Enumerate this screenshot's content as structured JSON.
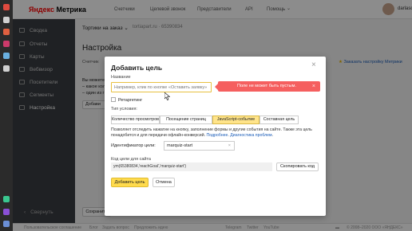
{
  "header": {
    "logo_ya": "Яндекс",
    "logo_rest": " Метрика",
    "nav": [
      "Счетчики",
      "Целевой звонок",
      "Представители",
      "API",
      "Помощь"
    ],
    "help_caret": "⌄",
    "user": "darlasoft"
  },
  "sidebar": {
    "items": [
      "Сводка",
      "Отчеты",
      "Карты",
      "Вебвизор",
      "Посетители",
      "Сегменты",
      "Настройка"
    ],
    "collapse": "Свернуть"
  },
  "page": {
    "counter_select": "Тортики на заказ",
    "counter_caret": "⌄",
    "site": "tortiapart.ru · 65390834",
    "title": "Настройка",
    "tab_partial": "Счетчик",
    "order_link": "Заказать настройку Метрики",
    "text1": "Вы можете с",
    "text2": "– какое кол",
    "text3": "– один из г",
    "add_partial": "Добави",
    "save": "Сохранить"
  },
  "modal": {
    "title": "Добавить цель",
    "close": "×",
    "name_label": "Название",
    "name_placeholder": "Например, клик по кнопке «Оставить заявку»",
    "retarget": "Ретаргетинг",
    "cond_label": "Тип условия:",
    "tabs": [
      "Количество просмотров",
      "Посещение страниц",
      "JavaScript-событие",
      "Составная цель"
    ],
    "desc1": "Позволяет отследить нажатие на кнопку, заполнение формы и другие события на сайте. Также эта цель",
    "desc2a": "понадобится и для передачи офлайн-конверсий. ",
    "desc2b": "Подробнее",
    "desc2c": ". ",
    "desc2d": "Диагностика проблем",
    "desc2e": ".",
    "id_label": "Идентификатор цели:",
    "id_value": "marquiz-start",
    "id_clear": "×",
    "code_label": "Код цели для сайта",
    "code_value": "ym(65380834,'reachGoal','marquiz-start')",
    "copy_btn": "Скопировать код",
    "submit": "Добавить цель",
    "cancel": "Отмена"
  },
  "error": {
    "text": "Поле не может быть пустым.",
    "icon": "×"
  },
  "footer": {
    "left": [
      "Пользовательское соглашение",
      "Блог",
      "Задать вопрос",
      "Предложить идею"
    ],
    "mid": [
      "Telegram",
      "Twitter",
      "YouTube"
    ],
    "right": "© 2008–2020 ООО «ЯНДЕКС»"
  },
  "colors": {
    "accent": "#ffdb4d",
    "error": "#f55f5f",
    "sidebar": "#3a3d42",
    "link": "#1a5cb8"
  }
}
